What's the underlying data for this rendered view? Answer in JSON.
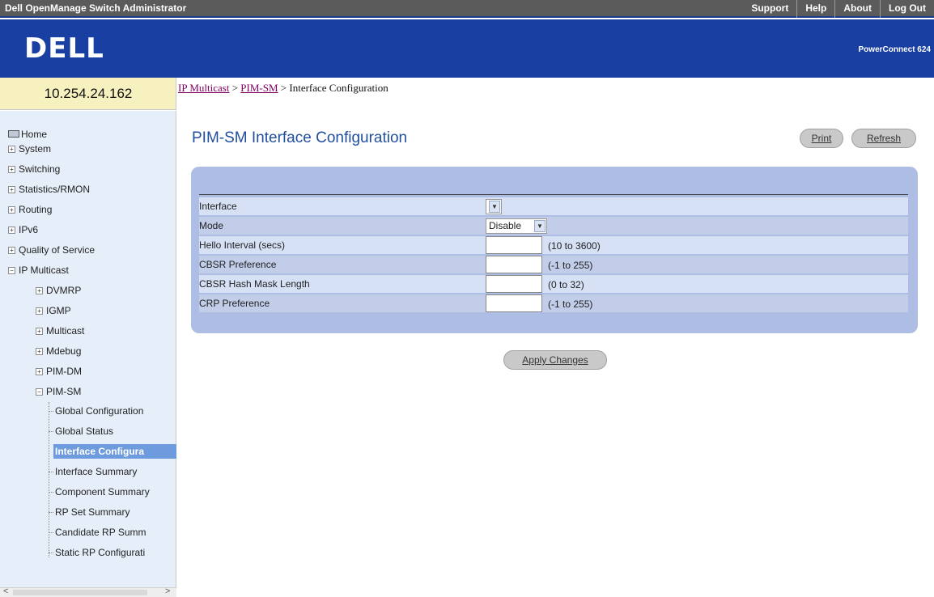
{
  "header": {
    "app_title": "Dell OpenManage Switch Administrator",
    "links": [
      "Support",
      "Help",
      "About",
      "Log Out"
    ],
    "logo": "DELL",
    "product": "PowerConnect 624"
  },
  "device": {
    "ip": "10.254.24.162"
  },
  "sidebar": {
    "home": "Home",
    "top_items": [
      {
        "label": "System",
        "toggle": "+"
      },
      {
        "label": "Switching",
        "toggle": "+"
      },
      {
        "label": "Statistics/RMON",
        "toggle": "+"
      },
      {
        "label": "Routing",
        "toggle": "+"
      },
      {
        "label": "IPv6",
        "toggle": "+"
      },
      {
        "label": "Quality of Service",
        "toggle": "+"
      },
      {
        "label": "IP Multicast",
        "toggle": "−"
      }
    ],
    "multicast_items": [
      {
        "label": "DVMRP",
        "toggle": "+"
      },
      {
        "label": "IGMP",
        "toggle": "+"
      },
      {
        "label": "Multicast",
        "toggle": "+"
      },
      {
        "label": "Mdebug",
        "toggle": "+"
      },
      {
        "label": "PIM-DM",
        "toggle": "+"
      },
      {
        "label": "PIM-SM",
        "toggle": "−"
      }
    ],
    "pimsm_items": [
      "Global Configuration",
      "Global Status",
      "Interface Configura",
      "Interface Summary",
      "Component Summary",
      "RP Set Summary",
      "Candidate RP Summ",
      "Static RP Configurati"
    ],
    "active_index": 2,
    "scroll_left": "<",
    "scroll_right": ">"
  },
  "breadcrumb": {
    "crumb1": "IP Multicast",
    "sep": " > ",
    "crumb2": "PIM-SM",
    "current": "Interface Configuration"
  },
  "page": {
    "title": "PIM-SM Interface Configuration",
    "print_label": "Print",
    "refresh_label": "Refresh",
    "apply_label": "Apply Changes"
  },
  "form": {
    "interface_label": "Interface",
    "interface_value": "",
    "mode_label": "Mode",
    "mode_value": "Disable",
    "hello_label": "Hello Interval (secs)",
    "hello_range": "(10 to 3600)",
    "cbsr_pref_label": "CBSR Preference",
    "cbsr_pref_range": "(-1 to 255)",
    "cbsr_hash_label": "CBSR Hash Mask Length",
    "cbsr_hash_range": "(0 to 32)",
    "crp_pref_label": "CRP Preference",
    "crp_pref_range": "(-1 to 255)",
    "dropdown_arrow": "▼"
  }
}
